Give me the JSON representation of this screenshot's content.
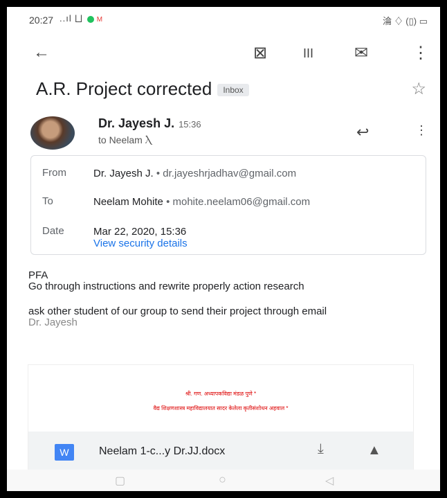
{
  "status": {
    "time": "20:27",
    "signal": "..ıl ⨆",
    "right": "淪 ♢ (▯) ▭"
  },
  "toolbar": {
    "back": "←",
    "archive": "⊠",
    "delete": "ΙΙΙ",
    "mail": "✉",
    "more": "⋮"
  },
  "email": {
    "subject": "A.R. Project corrected",
    "label": "Inbox",
    "sender": "Dr. Jayesh J.",
    "sent_time": "15:36",
    "to_line": "to Neelam Ⲗ",
    "details": {
      "from_label": "From",
      "from_name": "Dr. Jayesh J.",
      "from_email": "• dr.jayeshrjadhav@gmail.com",
      "to_label": "To",
      "to_name": "Neelam Mohite",
      "to_email": "• mohite.neelam06@gmail.com",
      "date_label": "Date",
      "date_value": "Mar 22, 2020, 15:36",
      "security_link": "View security details"
    },
    "body_lines": [
      "PFA",
      "Go through instructions and rewrite properly action research",
      "ask other student of our group to send their project through email"
    ],
    "signature": "Dr. Jayesh"
  },
  "attachment": {
    "preview_line1": "श्री. गण. अध्यापकविद्या मंडळ पुणे *",
    "preview_line2": "वैद्य शिक्षणशास्त्र महाविद्यालयात सादर केलेला कृतीसंशोधन अहवाल *",
    "type_icon": "W",
    "filename": "Neelam 1-c...y Dr.JJ.docx"
  }
}
